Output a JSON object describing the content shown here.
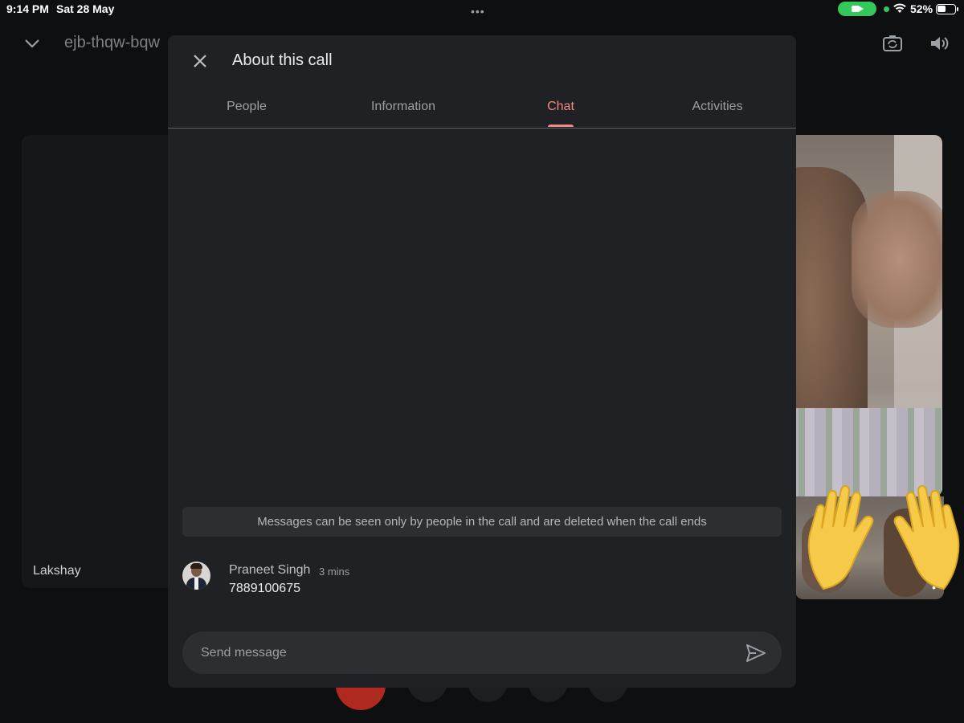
{
  "status_bar": {
    "time": "9:14 PM",
    "date": "Sat 28 May",
    "multitask_dots": "•••",
    "battery_percent": "52%",
    "battery_level": 0.52,
    "camera_indicator_color": "#34c759"
  },
  "meeting": {
    "code": "ejb-thqw-bqw",
    "collapse_icon": "chevron-down-icon",
    "switch_camera_icon": "camera-rotate-icon",
    "audio_icon": "speaker-icon"
  },
  "tiles": {
    "left_participant_name": "Lakshay"
  },
  "dialog": {
    "title": "About this call",
    "close_icon": "close-icon",
    "tabs": [
      {
        "label": "People",
        "active": false
      },
      {
        "label": "Information",
        "active": false
      },
      {
        "label": "Chat",
        "active": true
      },
      {
        "label": "Activities",
        "active": false
      }
    ],
    "accent_color": "#f28b82",
    "notice": "Messages can be seen only by people in the call and are deleted when the call ends",
    "messages": [
      {
        "sender": "Praneet Singh",
        "time": "3 mins",
        "text": "7889100675"
      }
    ],
    "composer": {
      "placeholder": "Send message",
      "value": "",
      "send_icon": "send-icon"
    }
  },
  "controls": {
    "end_call_color": "#b0291f"
  }
}
